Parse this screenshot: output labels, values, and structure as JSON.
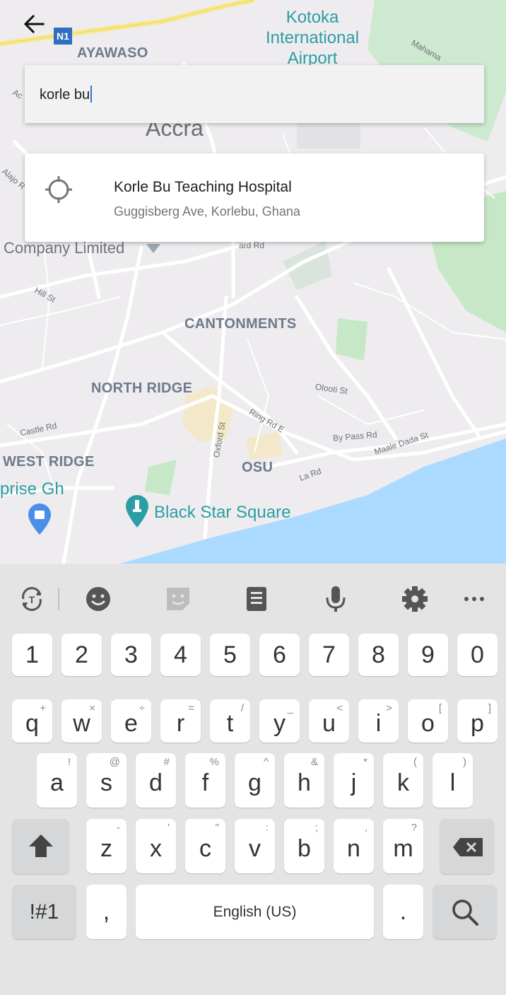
{
  "map": {
    "labels": {
      "ayawaso": "AYAWASO",
      "airport": "Kotoka\nInternational\nAirport",
      "accra": "Accra",
      "company": "Company Limited",
      "cantonments": "CANTONMENTS",
      "north_ridge": "NORTH RIDGE",
      "west_ridge": "WEST RIDGE",
      "osu": "OSU",
      "prise": "prise Gh",
      "black_star": "Black Star Square",
      "n1": "N1",
      "hill_st": "Hill St",
      "castle_rd": "Castle Rd",
      "oxford_st": "Oxford St",
      "ring_rd": "Ring Rd E",
      "oloti": "Olooti St",
      "bypass": "By Pass Rd",
      "maale": "Maale Dada St",
      "la_rd": "La Rd",
      "ard_rd": "ard Rd",
      "mahama": "Mahama",
      "alajo": "Alajo R",
      "ac": "Ac"
    }
  },
  "search": {
    "query": "korle bu"
  },
  "suggestion": {
    "title": "Korle Bu Teaching Hospital",
    "subtitle": "Guggisberg Ave, Korlebu, Ghana"
  },
  "keyboard": {
    "number_row": [
      "1",
      "2",
      "3",
      "4",
      "5",
      "6",
      "7",
      "8",
      "9",
      "0"
    ],
    "row1": [
      {
        "main": "q",
        "sub": "+"
      },
      {
        "main": "w",
        "sub": "×"
      },
      {
        "main": "e",
        "sub": "÷"
      },
      {
        "main": "r",
        "sub": "="
      },
      {
        "main": "t",
        "sub": "/"
      },
      {
        "main": "y",
        "sub": "_"
      },
      {
        "main": "u",
        "sub": "<"
      },
      {
        "main": "i",
        "sub": ">"
      },
      {
        "main": "o",
        "sub": "["
      },
      {
        "main": "p",
        "sub": "]"
      }
    ],
    "row2": [
      {
        "main": "a",
        "sub": "!"
      },
      {
        "main": "s",
        "sub": "@"
      },
      {
        "main": "d",
        "sub": "#"
      },
      {
        "main": "f",
        "sub": "%"
      },
      {
        "main": "g",
        "sub": "^"
      },
      {
        "main": "h",
        "sub": "&"
      },
      {
        "main": "j",
        "sub": "*"
      },
      {
        "main": "k",
        "sub": "("
      },
      {
        "main": "l",
        "sub": ")"
      }
    ],
    "row3": [
      {
        "main": "z",
        "sub": "-"
      },
      {
        "main": "x",
        "sub": "'"
      },
      {
        "main": "c",
        "sub": "\""
      },
      {
        "main": "v",
        "sub": ":"
      },
      {
        "main": "b",
        "sub": ";"
      },
      {
        "main": "n",
        "sub": ","
      },
      {
        "main": "m",
        "sub": "?"
      }
    ],
    "symbols_label": "!#1",
    "comma_label": ",",
    "space_label": "English (US)",
    "period_label": ".",
    "icons": [
      "translate-icon",
      "emoji-icon",
      "sticker-icon",
      "clipboard-icon",
      "mic-icon",
      "settings-icon",
      "more-icon",
      "shift-icon",
      "backspace-icon",
      "search-icon"
    ]
  },
  "colors": {
    "map_bg": "#eeecef",
    "water": "#aadaff",
    "park": "#c6e8c6",
    "poi_teal": "#2b9ea4",
    "highway": "#f6e98a",
    "caret": "#3b6fd8"
  }
}
